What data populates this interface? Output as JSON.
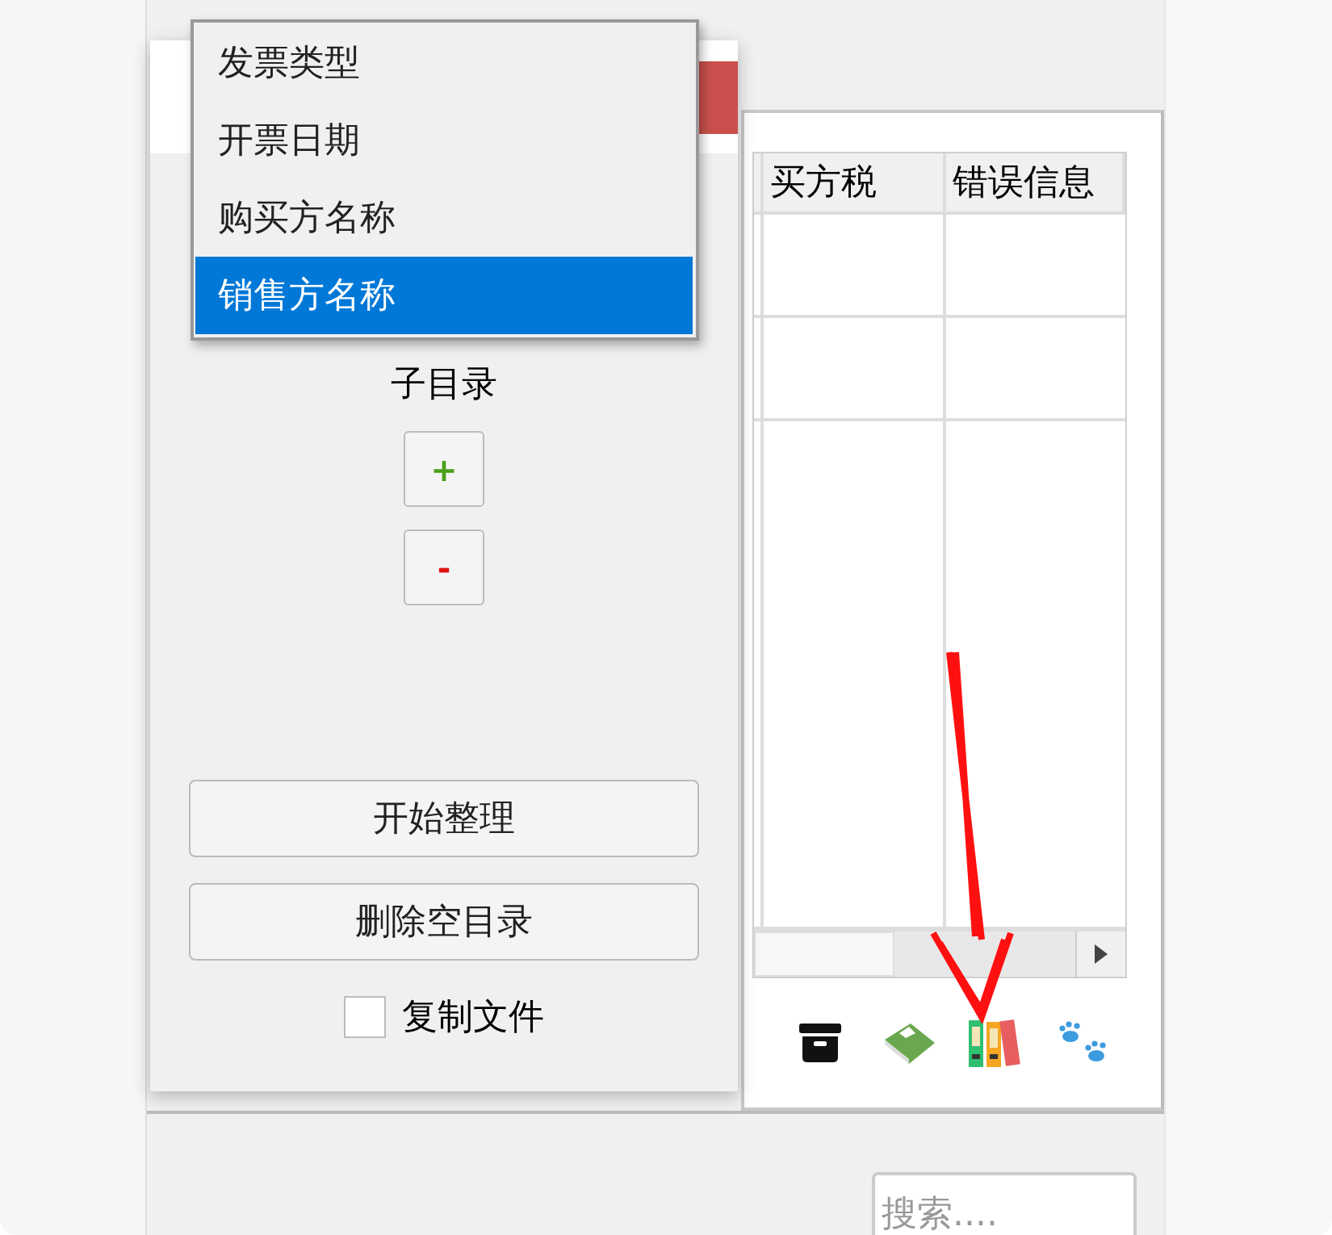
{
  "table": {
    "columns": [
      "买方税",
      "错误信息"
    ]
  },
  "search": {
    "placeholder": "搜索...."
  },
  "dialog": {
    "subdir_label": "子目录",
    "add_button": "+",
    "remove_button": "-",
    "actions": [
      "开始整理",
      "删除空目录"
    ],
    "copy_files": {
      "label": "复制文件",
      "checked": false
    }
  },
  "dropdown": {
    "items": [
      {
        "label": "发票类型",
        "selected": false
      },
      {
        "label": "开票日期",
        "selected": false
      },
      {
        "label": "购买方名称",
        "selected": false
      },
      {
        "label": "销售方名称",
        "selected": true
      }
    ]
  }
}
